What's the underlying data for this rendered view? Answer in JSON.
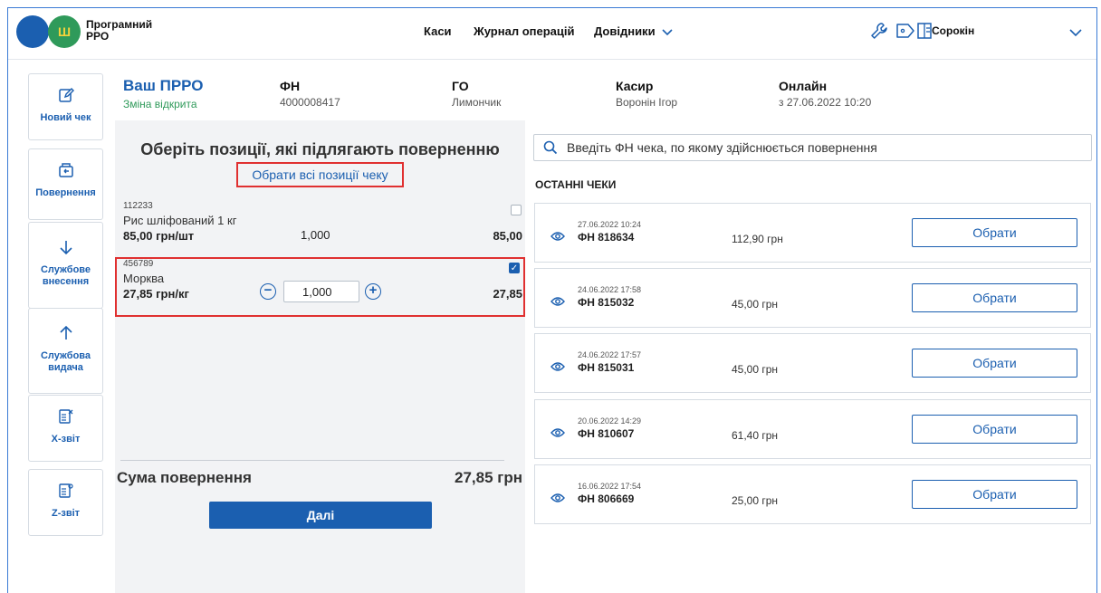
{
  "header": {
    "brand": "Програмний РРО",
    "nav": [
      {
        "label": "Каси"
      },
      {
        "label": "Журнал операцій"
      },
      {
        "label": "Довідники"
      }
    ],
    "user_name": "Сорокін"
  },
  "sidebar": {
    "items": [
      {
        "label": "Новий чек",
        "icon": "edit-icon"
      },
      {
        "label": "Повернення",
        "icon": "return-icon"
      },
      {
        "label": "Службове внесення",
        "icon": "arrow-down-icon"
      },
      {
        "label": "Службова видача",
        "icon": "arrow-up-icon"
      },
      {
        "label": "X-звіт",
        "icon": "x-report-icon"
      },
      {
        "label": "Z-звіт",
        "icon": "z-report-icon"
      }
    ]
  },
  "info": {
    "prro_title": "Ваш ПРРО",
    "prro_status": "Зміна відкрита",
    "fn_label": "ФН",
    "fn_value": "4000008417",
    "go_label": "ГО",
    "go_value": "Лимончик",
    "cashier_label": "Касир",
    "cashier_value": "Воронін Ігор",
    "online_label": "Онлайн",
    "online_value": "з 27.06.2022 10:20"
  },
  "return_panel": {
    "title": "Оберіть позиції, які підлягають поверненню",
    "select_all": "Обрати всі позиції чеку",
    "items": [
      {
        "code": "112233",
        "name": "Рис шліфований 1 кг",
        "price": "85,00 грн/шт",
        "qty": "1,000",
        "sum": "85,00",
        "checked": false
      },
      {
        "code": "456789",
        "name": "Морква",
        "price": "27,85 грн/кг",
        "qty": "1,000",
        "sum": "27,85",
        "checked": true
      }
    ],
    "sum_label": "Сума повернення",
    "sum_value": "27,85 грн",
    "next_label": "Далі"
  },
  "search": {
    "placeholder": "Введіть ФН чека, по якому здійснюється повернення"
  },
  "recent": {
    "title": "ОСТАННІ ЧЕКИ",
    "pick_label": "Обрати",
    "receipts": [
      {
        "datetime": "27.06.2022 10:24",
        "fn": "ФН 818634",
        "amount": "112,90 грн"
      },
      {
        "datetime": "24.06.2022 17:58",
        "fn": "ФН 815032",
        "amount": "45,00 грн"
      },
      {
        "datetime": "24.06.2022 17:57",
        "fn": "ФН 815031",
        "amount": "45,00 грн"
      },
      {
        "datetime": "20.06.2022 14:29",
        "fn": "ФН 810607",
        "amount": "61,40 грн"
      },
      {
        "datetime": "16.06.2022 17:54",
        "fn": "ФН 806669",
        "amount": "25,00 грн"
      }
    ]
  },
  "colors": {
    "primary": "#1b5fb0",
    "green": "#2f9a5a",
    "highlight": "#e03030"
  }
}
